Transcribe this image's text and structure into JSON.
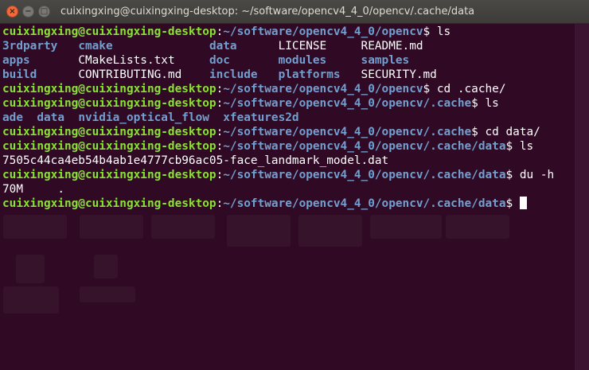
{
  "window": {
    "title": "cuixingxing@cuixingxing-desktop: ~/software/opencv4_4_0/opencv/.cache/data",
    "close_glyph": "×",
    "minimize_glyph": "−",
    "maximize_glyph": "□"
  },
  "colors": {
    "terminal_bg": "#300a24",
    "user_host": "#8ae234",
    "path": "#729fcf",
    "directory": "#729fcf",
    "text": "#ffffff",
    "close_button": "#ef6a3c"
  },
  "prompt": {
    "user_host": "cuixingxing@cuixingxing-desktop",
    "separator": ":",
    "suffix": "$ "
  },
  "session": [
    {
      "path": "~/software/opencv4_4_0/opencv",
      "command": "ls",
      "output": [
        [
          {
            "text": "3rdparty",
            "kind": "dir",
            "width": 11
          },
          {
            "text": "cmake",
            "kind": "dir",
            "width": 19
          },
          {
            "text": "data",
            "kind": "dir",
            "width": 10
          },
          {
            "text": "LICENSE",
            "kind": "file",
            "width": 12
          },
          {
            "text": "README.md",
            "kind": "file",
            "width": 0
          }
        ],
        [
          {
            "text": "apps",
            "kind": "dir",
            "width": 11
          },
          {
            "text": "CMakeLists.txt",
            "kind": "file",
            "width": 19
          },
          {
            "text": "doc",
            "kind": "dir",
            "width": 10
          },
          {
            "text": "modules",
            "kind": "dir",
            "width": 12
          },
          {
            "text": "samples",
            "kind": "dir",
            "width": 0
          }
        ],
        [
          {
            "text": "build",
            "kind": "dir",
            "width": 11
          },
          {
            "text": "CONTRIBUTING.md",
            "kind": "file",
            "width": 19
          },
          {
            "text": "include",
            "kind": "dir",
            "width": 10
          },
          {
            "text": "platforms",
            "kind": "dir",
            "width": 12
          },
          {
            "text": "SECURITY.md",
            "kind": "file",
            "width": 0
          }
        ]
      ]
    },
    {
      "path": "~/software/opencv4_4_0/opencv",
      "command": "cd .cache/",
      "output": []
    },
    {
      "path": "~/software/opencv4_4_0/opencv/.cache",
      "command": "ls",
      "output": [
        [
          {
            "text": "ade",
            "kind": "dir",
            "width": 5
          },
          {
            "text": "data",
            "kind": "dir",
            "width": 6
          },
          {
            "text": "nvidia_optical_flow",
            "kind": "dir",
            "width": 21
          },
          {
            "text": "xfeatures2d",
            "kind": "dir",
            "width": 0
          }
        ]
      ]
    },
    {
      "path": "~/software/opencv4_4_0/opencv/.cache",
      "command": "cd data/",
      "output": []
    },
    {
      "path": "~/software/opencv4_4_0/opencv/.cache/data",
      "command": "ls",
      "output": [
        [
          {
            "text": "7505c44ca4eb54b4ab1e4777cb96ac05-face_landmark_model.dat",
            "kind": "file",
            "width": 0
          }
        ]
      ]
    },
    {
      "path": "~/software/opencv4_4_0/opencv/.cache/data",
      "command": "du -h",
      "output": [
        [
          {
            "text": "70M",
            "kind": "file",
            "width": 8
          },
          {
            "text": ".",
            "kind": "file",
            "width": 0
          }
        ]
      ]
    }
  ],
  "current_prompt": {
    "path": "~/software/opencv4_4_0/opencv/.cache/data",
    "input": ""
  }
}
